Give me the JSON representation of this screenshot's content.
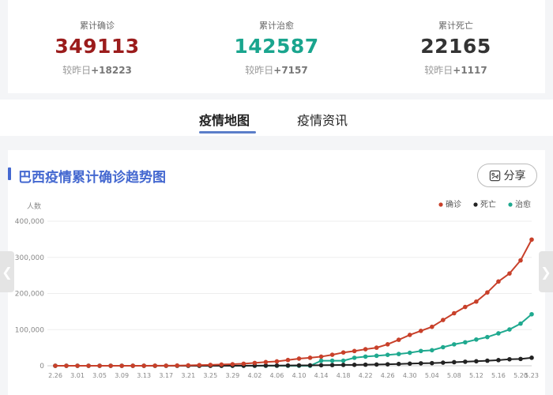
{
  "stats": [
    {
      "label": "累计确诊",
      "value": "349113",
      "delta_prefix": "较昨日",
      "delta": "+18223",
      "color": "#9b1c1c"
    },
    {
      "label": "累计治愈",
      "value": "142587",
      "delta_prefix": "较昨日",
      "delta": "+7157",
      "color": "#1aa58e"
    },
    {
      "label": "累计死亡",
      "value": "22165",
      "delta_prefix": "较昨日",
      "delta": "+1117",
      "color": "#333333"
    }
  ],
  "tabs": [
    {
      "label": "疫情地图",
      "active": true
    },
    {
      "label": "疫情资讯",
      "active": false
    }
  ],
  "card": {
    "title": "巴西疫情累计确诊趋势图",
    "share_label": "分享",
    "share_icon": "share-icon"
  },
  "nav": {
    "left_icon": "chevron-left-icon",
    "right_icon": "chevron-right-icon"
  },
  "chart_data": {
    "type": "line",
    "title": "巴西疫情累计确诊趋势图",
    "ylabel": "人数",
    "ylim": [
      0,
      400000
    ],
    "yticks": [
      "0",
      "100,000",
      "200,000",
      "300,000",
      "400,000"
    ],
    "grid": true,
    "legend_position": "top-right",
    "x": [
      "2.26",
      "2.28",
      "3.01",
      "3.03",
      "3.05",
      "3.07",
      "3.09",
      "3.11",
      "3.13",
      "3.15",
      "3.17",
      "3.19",
      "3.21",
      "3.23",
      "3.25",
      "3.27",
      "3.29",
      "3.31",
      "4.02",
      "4.04",
      "4.06",
      "4.08",
      "4.10",
      "4.12",
      "4.14",
      "4.16",
      "4.18",
      "4.20",
      "4.22",
      "4.24",
      "4.26",
      "4.28",
      "4.30",
      "5.02",
      "5.04",
      "5.06",
      "5.08",
      "5.10",
      "5.12",
      "5.14",
      "5.16",
      "5.18",
      "5.20",
      "5.23"
    ],
    "xtick_labels": [
      "2.26",
      "3.01",
      "3.05",
      "3.09",
      "3.13",
      "3.17",
      "3.21",
      "3.25",
      "3.29",
      "4.02",
      "4.06",
      "4.10",
      "4.14",
      "4.18",
      "4.22",
      "4.26",
      "4.30",
      "5.04",
      "5.08",
      "5.12",
      "5.16",
      "5.20",
      "5.23"
    ],
    "series": [
      {
        "name": "确诊",
        "color": "#c8402a",
        "values": [
          1,
          2,
          2,
          2,
          8,
          19,
          25,
          52,
          77,
          200,
          291,
          621,
          1128,
          1891,
          2433,
          3417,
          4256,
          5717,
          7910,
          10278,
          12056,
          15927,
          19789,
          22169,
          25262,
          30425,
          36722,
          40743,
          45757,
          50036,
          59324,
          71886,
          85380,
          96559,
          107780,
          126611,
          145328,
          162699,
          177589,
          202918,
          233142,
          255368,
          291579,
          349113
        ]
      },
      {
        "name": "死亡",
        "color": "#222222",
        "values": [
          0,
          0,
          0,
          0,
          0,
          0,
          0,
          0,
          0,
          0,
          1,
          4,
          18,
          34,
          57,
          92,
          136,
          201,
          299,
          432,
          553,
          800,
          1057,
          1223,
          1532,
          1924,
          2361,
          2587,
          3001,
          3459,
          4016,
          5017,
          5901,
          6761,
          7321,
          8588,
          9897,
          11123,
          12461,
          13999,
          15633,
          17983,
          18859,
          22165
        ]
      },
      {
        "name": "治愈",
        "color": "#1fa98f",
        "values": [
          0,
          0,
          0,
          0,
          0,
          0,
          0,
          0,
          0,
          0,
          0,
          0,
          0,
          0,
          0,
          0,
          0,
          0,
          0,
          0,
          0,
          0,
          0,
          0,
          14026,
          14026,
          14026,
          22130,
          25318,
          27655,
          30152,
          32544,
          35935,
          40937,
          42991,
          51370,
          59297,
          64957,
          72597,
          79479,
          89672,
          100459,
          116683,
          142587
        ]
      }
    ]
  }
}
